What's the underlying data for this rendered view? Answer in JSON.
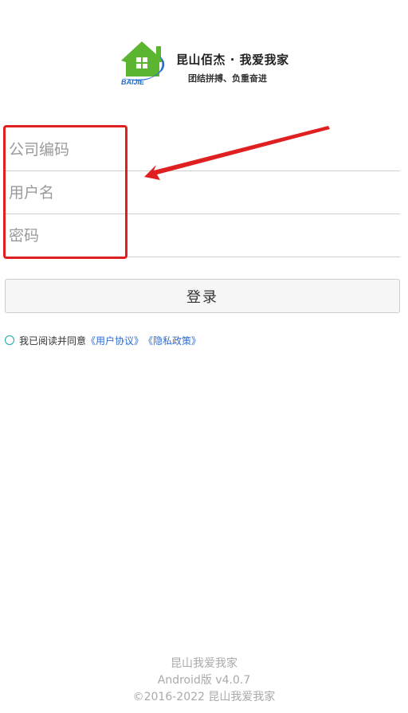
{
  "logo": {
    "brand_text": "BAIJIE",
    "title": "昆山佰杰 · 我爱我家",
    "slogan": "团结拼搏、负重奋进",
    "colors": {
      "house": "#5cb531",
      "swoosh": "#1f6fd6"
    }
  },
  "form": {
    "company_code": {
      "placeholder": "公司编码",
      "value": ""
    },
    "username": {
      "placeholder": "用户名",
      "value": ""
    },
    "password": {
      "placeholder": "密码",
      "value": ""
    }
  },
  "login": {
    "label": "登录"
  },
  "agreement": {
    "prefix": "我已阅读并同意",
    "user_agreement": "《用户协议》",
    "privacy_policy": "《隐私政策》",
    "checked": false
  },
  "footer": {
    "app_name": "昆山我爱我家",
    "version": "Android版  v4.0.7",
    "copyright": "©2016-2022 昆山我爱我家"
  },
  "annotation": {
    "color": "#e02020"
  }
}
